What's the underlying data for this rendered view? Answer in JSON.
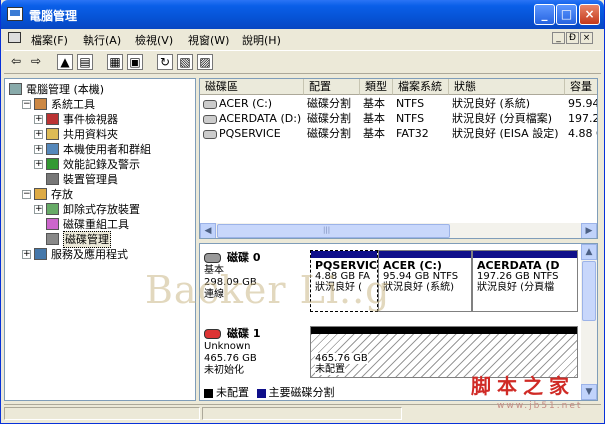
{
  "window": {
    "title": "電腦管理"
  },
  "menu": [
    "檔案(F)",
    "執行(A)",
    "檢視(V)",
    "視窗(W)",
    "說明(H)"
  ],
  "mdi_controls": [
    "_",
    "Ð",
    "×"
  ],
  "tree": [
    {
      "label": "電腦管理 (本機)",
      "level": 0,
      "expander": ""
    },
    {
      "label": "系統工具",
      "level": 1,
      "expander": "−"
    },
    {
      "label": "事件檢視器",
      "level": 2,
      "expander": "+"
    },
    {
      "label": "共用資料夾",
      "level": 2,
      "expander": "+"
    },
    {
      "label": "本機使用者和群組",
      "level": 2,
      "expander": "+"
    },
    {
      "label": "效能記錄及警示",
      "level": 2,
      "expander": "+"
    },
    {
      "label": "裝置管理員",
      "level": 2,
      "expander": ""
    },
    {
      "label": "存放",
      "level": 1,
      "expander": "−"
    },
    {
      "label": "卸除式存放裝置",
      "level": 2,
      "expander": "+"
    },
    {
      "label": "磁碟重組工具",
      "level": 2,
      "expander": ""
    },
    {
      "label": "磁碟管理",
      "level": 2,
      "expander": "",
      "selected": true
    },
    {
      "label": "服務及應用程式",
      "level": 1,
      "expander": "+"
    }
  ],
  "volumes": {
    "headers": [
      "磁碟區",
      "配置",
      "類型",
      "檔案系統",
      "狀態",
      "容量"
    ],
    "rows": [
      [
        "ACER (C:)",
        "磁碟分割",
        "基本",
        "NTFS",
        "狀況良好 (系統)",
        "95.94"
      ],
      [
        "ACERDATA (D:)",
        "磁碟分割",
        "基本",
        "NTFS",
        "狀況良好 (分頁檔案)",
        "197.26"
      ],
      [
        "PQSERVICE",
        "磁碟分割",
        "基本",
        "FAT32",
        "狀況良好 (EISA 設定)",
        "4.88 G"
      ]
    ],
    "scroll_mid": "|||"
  },
  "disks": [
    {
      "name": "磁碟 0",
      "lines": [
        "基本",
        "298.09 GB",
        "連線"
      ],
      "partitions": [
        {
          "name": "PQSERVIC",
          "size": "4.88 GB FA",
          "status": "狀況良好 (",
          "selected": true
        },
        {
          "name": "ACER  (C:)",
          "size": "95.94 GB NTFS",
          "status": "狀況良好 (系統)"
        },
        {
          "name": "ACERDATA  (D",
          "size": "197.26 GB NTFS",
          "status": "狀況良好 (分頁檔"
        }
      ]
    },
    {
      "name": "磁碟 1",
      "lines": [
        "Unknown",
        "465.76 GB",
        "未初始化"
      ],
      "partitions": [
        {
          "size": "465.76 GB",
          "status": "未配置"
        }
      ]
    }
  ],
  "legend": [
    {
      "label": "未配置",
      "color": "#000000"
    },
    {
      "label": "主要磁碟分割",
      "color": "#0f0f8a"
    }
  ],
  "watermark": {
    "text": "Backer Li..g",
    "site_cn": "脚本之家",
    "site_url": "www.jb51.net"
  }
}
